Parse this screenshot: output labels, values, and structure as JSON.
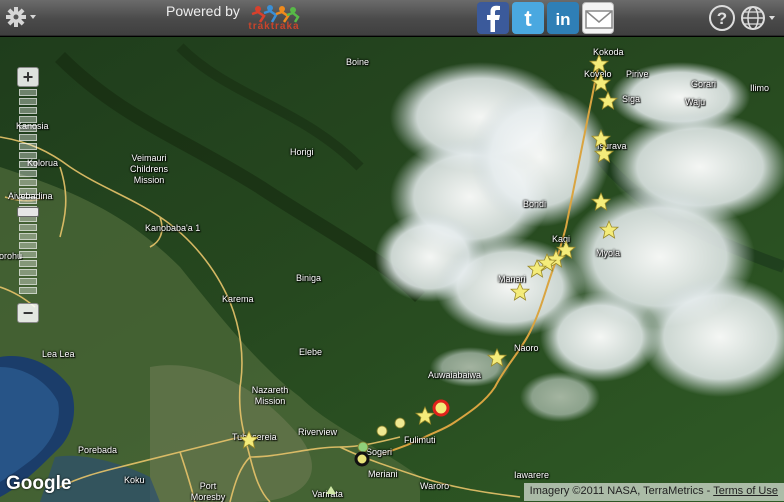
{
  "topbar": {
    "powered_by": "Powered by",
    "brand_name": "traktraka",
    "share_buttons": [
      "facebook",
      "twitter",
      "linkedin",
      "email"
    ],
    "help_icon": "help-icon",
    "globe_icon": "globe-icon",
    "settings_icon": "gear-icon"
  },
  "map": {
    "provider": "Google",
    "attribution": "Imagery ©2011 NASA, TerraMetrics -",
    "terms_label": "Terms of Use",
    "zoom_in": "+",
    "zoom_out": "−",
    "places": {
      "boine": "Boine",
      "kokoda": "Kokoda",
      "kovelo": "Kovelo",
      "pirive": "Pirive",
      "gorari": "Gorari",
      "ilimo": "Ilimo",
      "waju": "Waju",
      "siga": "Siga",
      "isurava": "Isurava",
      "kanosia": "Kanosia",
      "veimauri": "Veimauri Childrens Mission",
      "horigi": "Horigi",
      "kolorua": "Kolorua",
      "aivebadina": "Aivebadina",
      "bondi": "Bondi",
      "kanobabaa": "Kanobaba'a 1",
      "kagi": "Kagi",
      "myola": "Myola",
      "gorohu": "Gorohu",
      "manari": "Manari",
      "biniga": "Biniga",
      "karema": "Karema",
      "elebe": "Elebe",
      "naoro": "Naoro",
      "lealea": "Lea Lea",
      "auwaiabaiwa": "Auwaiabaiwa",
      "nazareth": "Nazareth Mission",
      "riverview": "Riverview",
      "fulimuti": "Fulimuti",
      "sogeri": "Sogeri",
      "porebada": "Porebada",
      "tubuseria": "Tubusereia",
      "koku": "Koku",
      "meriani": "Meriani",
      "portmoresby": "Port Moresby",
      "waroro": "Waroro",
      "iawarere": "Iawarere",
      "varirata": "Varirata"
    },
    "colors": {
      "trail": "#d9a441",
      "road": "#e8c46a",
      "star": "#f4ec7a",
      "current_marker": "#e0211b"
    }
  }
}
